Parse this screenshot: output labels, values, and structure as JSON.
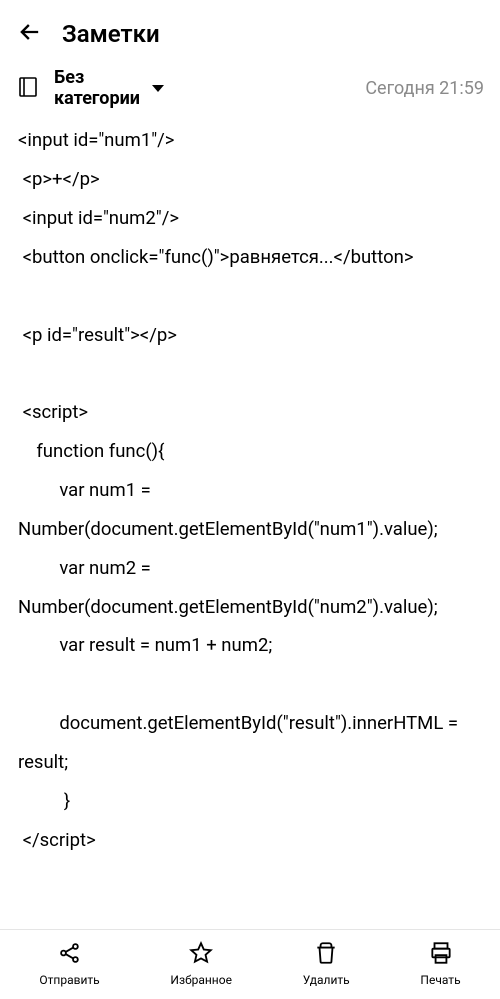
{
  "header": {
    "title": "Заметки"
  },
  "meta": {
    "category_line1": "Без",
    "category_line2": "категории",
    "timestamp": "Сегодня 21:59"
  },
  "note": {
    "lines": [
      "<input id=\"num1\"/>",
      " <p>+</p>",
      " <input id=\"num2\"/>",
      " <button onclick=\"func()\">равняется...</button>",
      "",
      " <p id=\"result\"></p>",
      "",
      " <script>",
      "    function func(){",
      "         var num1 = Number(document.getElementById(\"num1\").value);",
      "         var num2 = Number(document.getElementById(\"num2\").value);",
      "         var result = num1 + num2;",
      "",
      "         document.getElementById(\"result\").innerHTML = result;",
      "          }",
      " </script>"
    ]
  },
  "toolbar": {
    "send": "Отправить",
    "favorite": "Избранное",
    "delete": "Удалить",
    "print": "Печать"
  }
}
